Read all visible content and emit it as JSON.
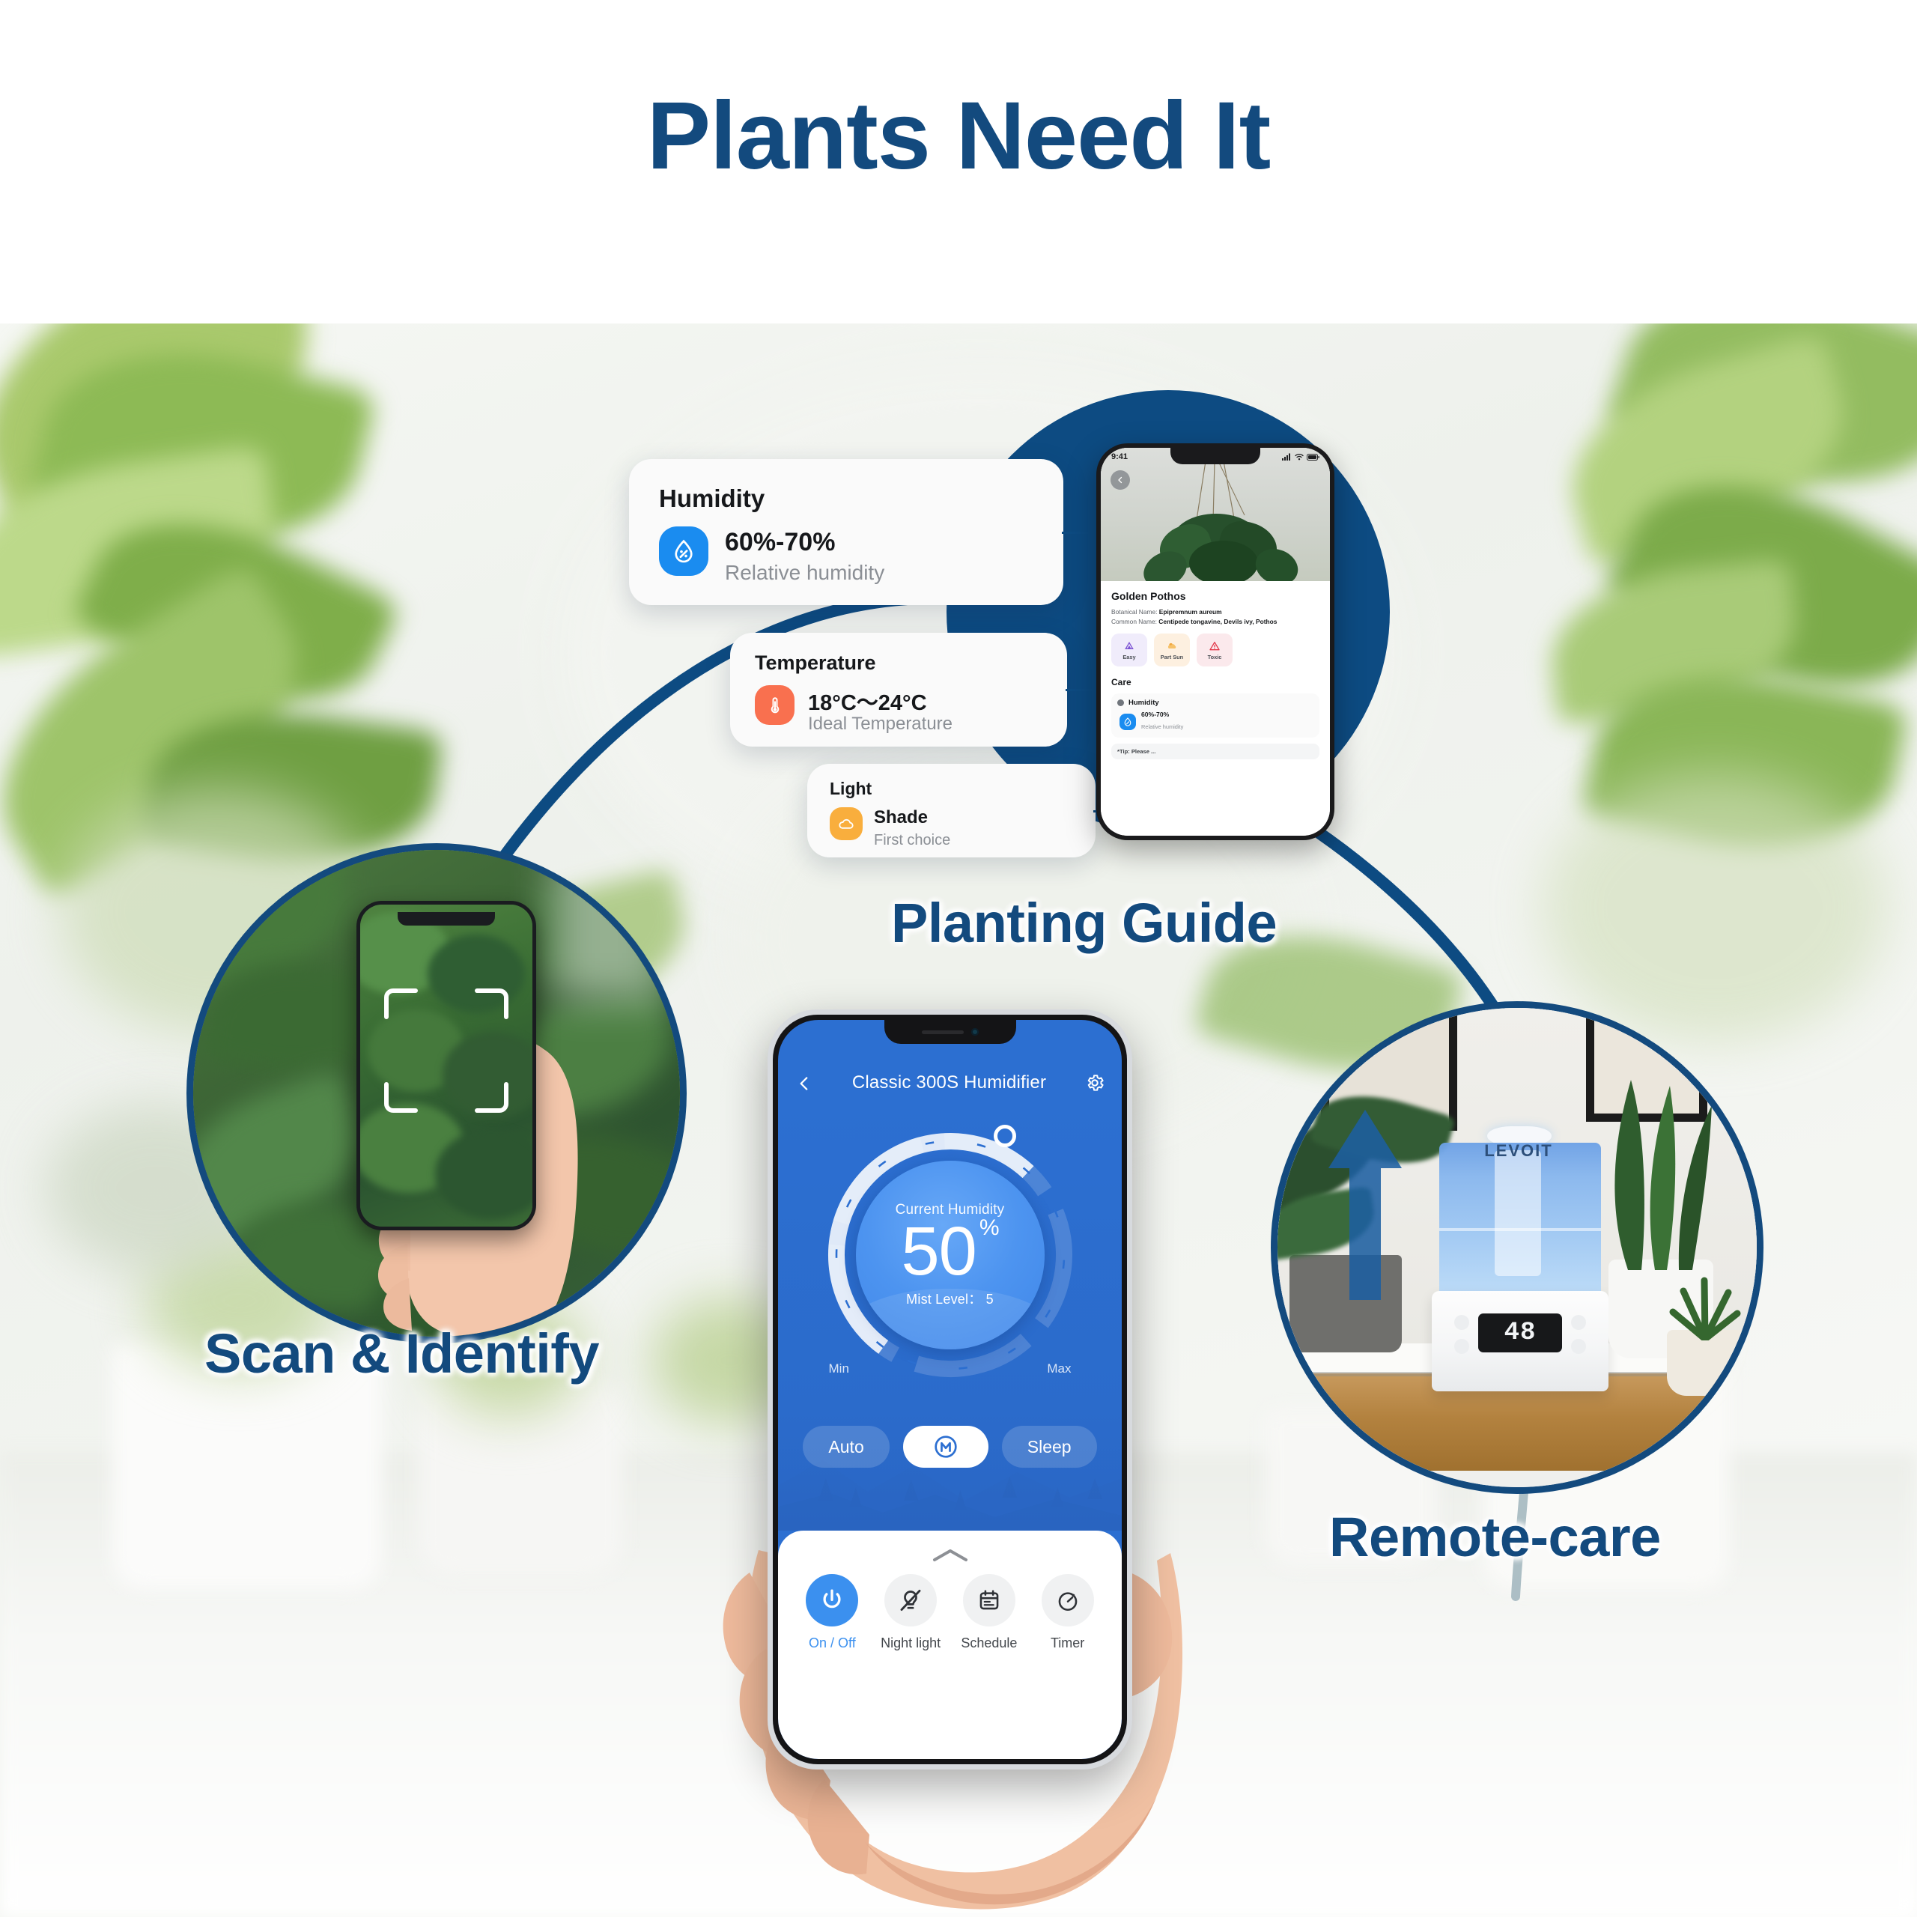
{
  "header": {
    "title": "Plants Need It"
  },
  "colors": {
    "brand_dark_blue": "#134a7e",
    "disc_blue": "#0d4b82",
    "app_blue": "#2c6fd1",
    "accent_blue": "#1a8cf0",
    "accent_orange_temp": "#f9704f",
    "accent_orange_light": "#f9ae3d",
    "dial_light": "#67a8f7"
  },
  "sections": [
    {
      "id": "scan",
      "label": "Scan & Identify"
    },
    {
      "id": "guide",
      "label": "Planting Guide"
    },
    {
      "id": "remote",
      "label": "Remote-care"
    }
  ],
  "care_cards": [
    {
      "title": "Humidity",
      "value": "60%-70%",
      "subtitle": "Relative humidity",
      "icon": "humidity-drop-icon",
      "icon_color": "#1a8cf0"
    },
    {
      "title": "Temperature",
      "value": "18°C～24°C",
      "subtitle": "Ideal Temperature",
      "icon": "thermometer-icon",
      "icon_color": "#f9704f"
    },
    {
      "title": "Light",
      "value": "Shade",
      "subtitle": "First choice",
      "icon": "cloud-shade-icon",
      "icon_color": "#f9ae3d"
    }
  ],
  "plant_phone": {
    "status_time": "9:41",
    "back_icon": "chevron-left-icon",
    "plant_name": "Golden Pothos",
    "botanical_label": "Botanical Name:",
    "botanical_value": "Epipremnum aureum",
    "common_label": "Common Name:",
    "common_value": "Centipede tongavine, Devils ivy, Pothos",
    "tags": [
      {
        "label": "Easy",
        "icon": "difficulty-icon",
        "bg": "#f0ecfb",
        "color": "#7b52d3"
      },
      {
        "label": "Part Sun",
        "icon": "part-sun-icon",
        "bg": "#fdf0e0",
        "color": "#eba13c"
      },
      {
        "label": "Toxic",
        "icon": "toxic-warning-icon",
        "bg": "#fbe9ec",
        "color": "#e2384a"
      }
    ],
    "care_heading": "Care",
    "care_item": {
      "label": "Humidity",
      "value": "60%-70%",
      "subtitle": "Relative humidity",
      "icon": "humidity-drop-icon"
    },
    "tip_text": "*Tip:  Please ..."
  },
  "humidifier_phone": {
    "back_icon": "chevron-left-icon",
    "title": "Classic 300S Humidifier",
    "settings_icon": "gear-icon",
    "dial": {
      "label": "Current Humidity",
      "value": "50",
      "unit": "%",
      "mist_label": "Mist Level：",
      "mist_value": "5",
      "min_label": "Min",
      "max_label": "Max",
      "knob_position_pct": 72
    },
    "modes": [
      {
        "label": "Auto",
        "active": false
      },
      {
        "label": "M",
        "active": true,
        "icon": "manual-mode-icon"
      },
      {
        "label": "Sleep",
        "active": false
      }
    ],
    "sheet": {
      "handle_icon": "chevron-up-icon",
      "quick_actions": [
        {
          "label": "On / Off",
          "icon": "power-icon",
          "active": true
        },
        {
          "label": "Night light",
          "icon": "night-light-off-icon",
          "active": false
        },
        {
          "label": "Schedule",
          "icon": "calendar-icon",
          "active": false
        },
        {
          "label": "Timer",
          "icon": "timer-icon",
          "active": false
        }
      ]
    }
  },
  "remote_scene": {
    "brand": "LEVOIT",
    "display_value": "48",
    "arrow_icon": "mist-up-arrow-icon"
  }
}
